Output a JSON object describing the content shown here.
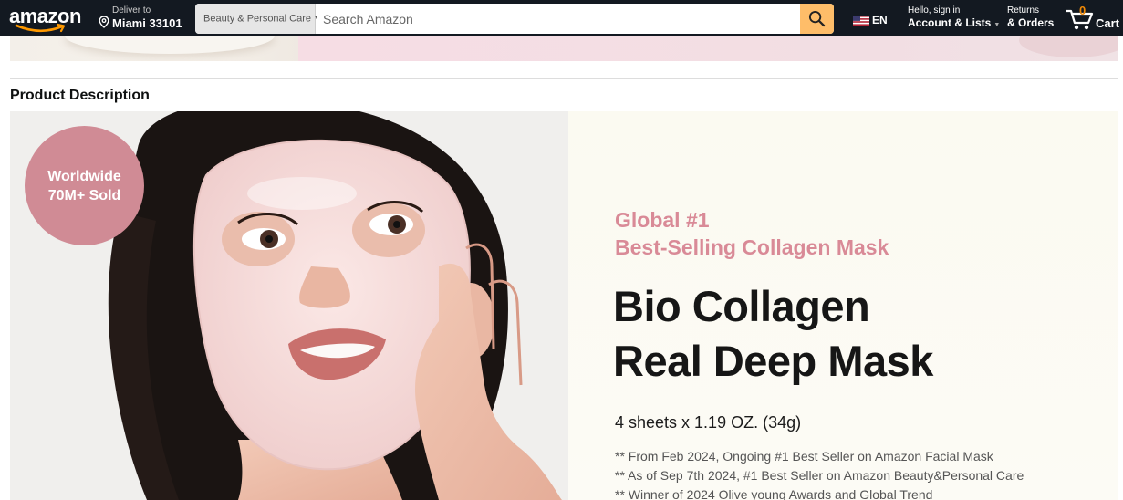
{
  "nav": {
    "logo_text": "amazon",
    "deliver_to_label": "Deliver to",
    "deliver_to_location": "Miami 33101",
    "search_category": "Beauty & Personal Care",
    "search_placeholder": "Search Amazon",
    "language": "EN",
    "account_greeting": "Hello, sign in",
    "account_label": "Account & Lists",
    "returns_label": "Returns",
    "orders_label": "& Orders",
    "cart_count": "0",
    "cart_label": "Cart"
  },
  "section": {
    "title": "Product Description"
  },
  "product": {
    "badge_line1": "Worldwide",
    "badge_line2": "70M+ Sold",
    "tagline_line1": "Global #1",
    "tagline_line2": "Best-Selling Collagen Mask",
    "title_line1": "Bio Collagen",
    "title_line2": "Real Deep Mask",
    "size": "4 sheets x 1.19 OZ. (34g)",
    "notes": [
      "** From Feb 2024, Ongoing #1 Best Seller on Amazon Facial Mask",
      "** As of Sep 7th 2024, #1 Best Seller on Amazon Beauty&Personal Care",
      "** Winner of 2024 Olive young Awards and Global Trend"
    ]
  },
  "colors": {
    "nav_bg": "#131921",
    "search_button": "#febd69",
    "cart_count": "#f08804",
    "badge_pink": "#d08b95",
    "tagline_pink": "#d98a97"
  }
}
